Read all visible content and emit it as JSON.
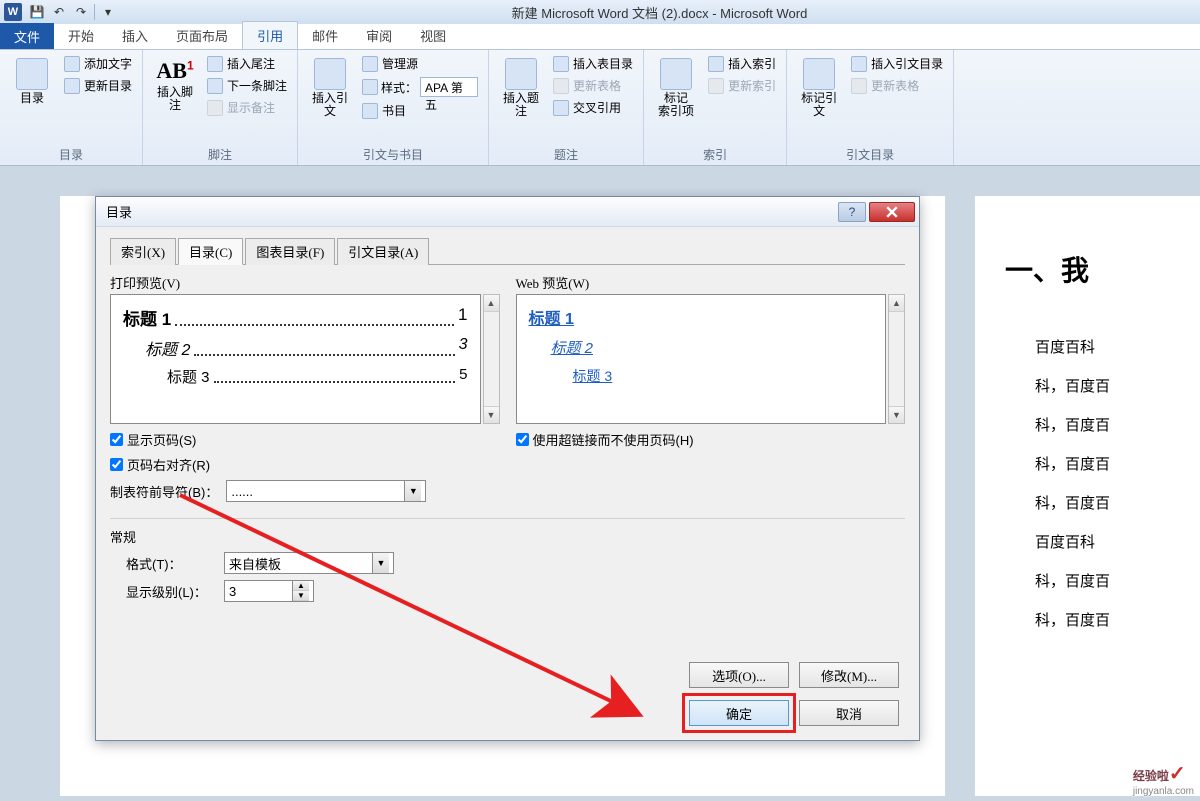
{
  "title": "新建 Microsoft Word 文档 (2).docx - Microsoft Word",
  "tabs": {
    "file": "文件",
    "home": "开始",
    "insert": "插入",
    "layout": "页面布局",
    "references": "引用",
    "mail": "邮件",
    "review": "审阅",
    "view": "视图"
  },
  "ribbon": {
    "toc": {
      "big": "目录",
      "addText": "添加文字",
      "update": "更新目录",
      "group": "目录"
    },
    "footnote": {
      "big": "插入脚注",
      "ab": "AB",
      "endnote": "插入尾注",
      "next": "下一条脚注",
      "show": "显示备注",
      "group": "脚注"
    },
    "citation": {
      "big": "插入引文",
      "manage": "管理源",
      "styleLabel": "样式：",
      "styleValue": "APA 第五",
      "biblio": "书目",
      "group": "引文与书目"
    },
    "caption": {
      "big": "插入题注",
      "insertTable": "插入表目录",
      "updateTable": "更新表格",
      "crossref": "交叉引用",
      "group": "题注"
    },
    "index": {
      "big": "标记\n索引项",
      "insert": "插入索引",
      "update": "更新索引",
      "group": "索引"
    },
    "authorities": {
      "big": "标记引文",
      "insert": "插入引文目录",
      "update": "更新表格",
      "group": "引文目录"
    }
  },
  "dialog": {
    "title": "目录",
    "tabs": {
      "index": "索引(X)",
      "toc": "目录(C)",
      "figures": "图表目录(F)",
      "authorities": "引文目录(A)"
    },
    "printPreview": "打印预览(V)",
    "webPreview": "Web 预览(W)",
    "previewItems": {
      "h1": "标题 1",
      "p1": "1",
      "h2": "标题 2",
      "p2": "3",
      "h3": "标题 3",
      "p3": "5"
    },
    "showPages": "显示页码(S)",
    "rightAlign": "页码右对齐(R)",
    "useHyperlinks": "使用超链接而不使用页码(H)",
    "leaderLabel": "制表符前导符(B)：",
    "leaderValue": "......",
    "general": "常规",
    "formatLabel": "格式(T)：",
    "formatValue": "来自模板",
    "levelsLabel": "显示级别(L)：",
    "levelsValue": "3",
    "options": "选项(O)...",
    "modify": "修改(M)...",
    "ok": "确定",
    "cancel": "取消"
  },
  "document": {
    "heading": "一、我",
    "p1": "百度百科",
    "p2": "科，百度百",
    "p3": "科，百度百",
    "p4": "科，百度百",
    "p5": "科，百度百",
    "p6": "百度百科",
    "p7": "科，百度百",
    "p8": "科，百度百"
  },
  "watermark": {
    "brand": "经验啦",
    "url": "jingyanla.com"
  }
}
